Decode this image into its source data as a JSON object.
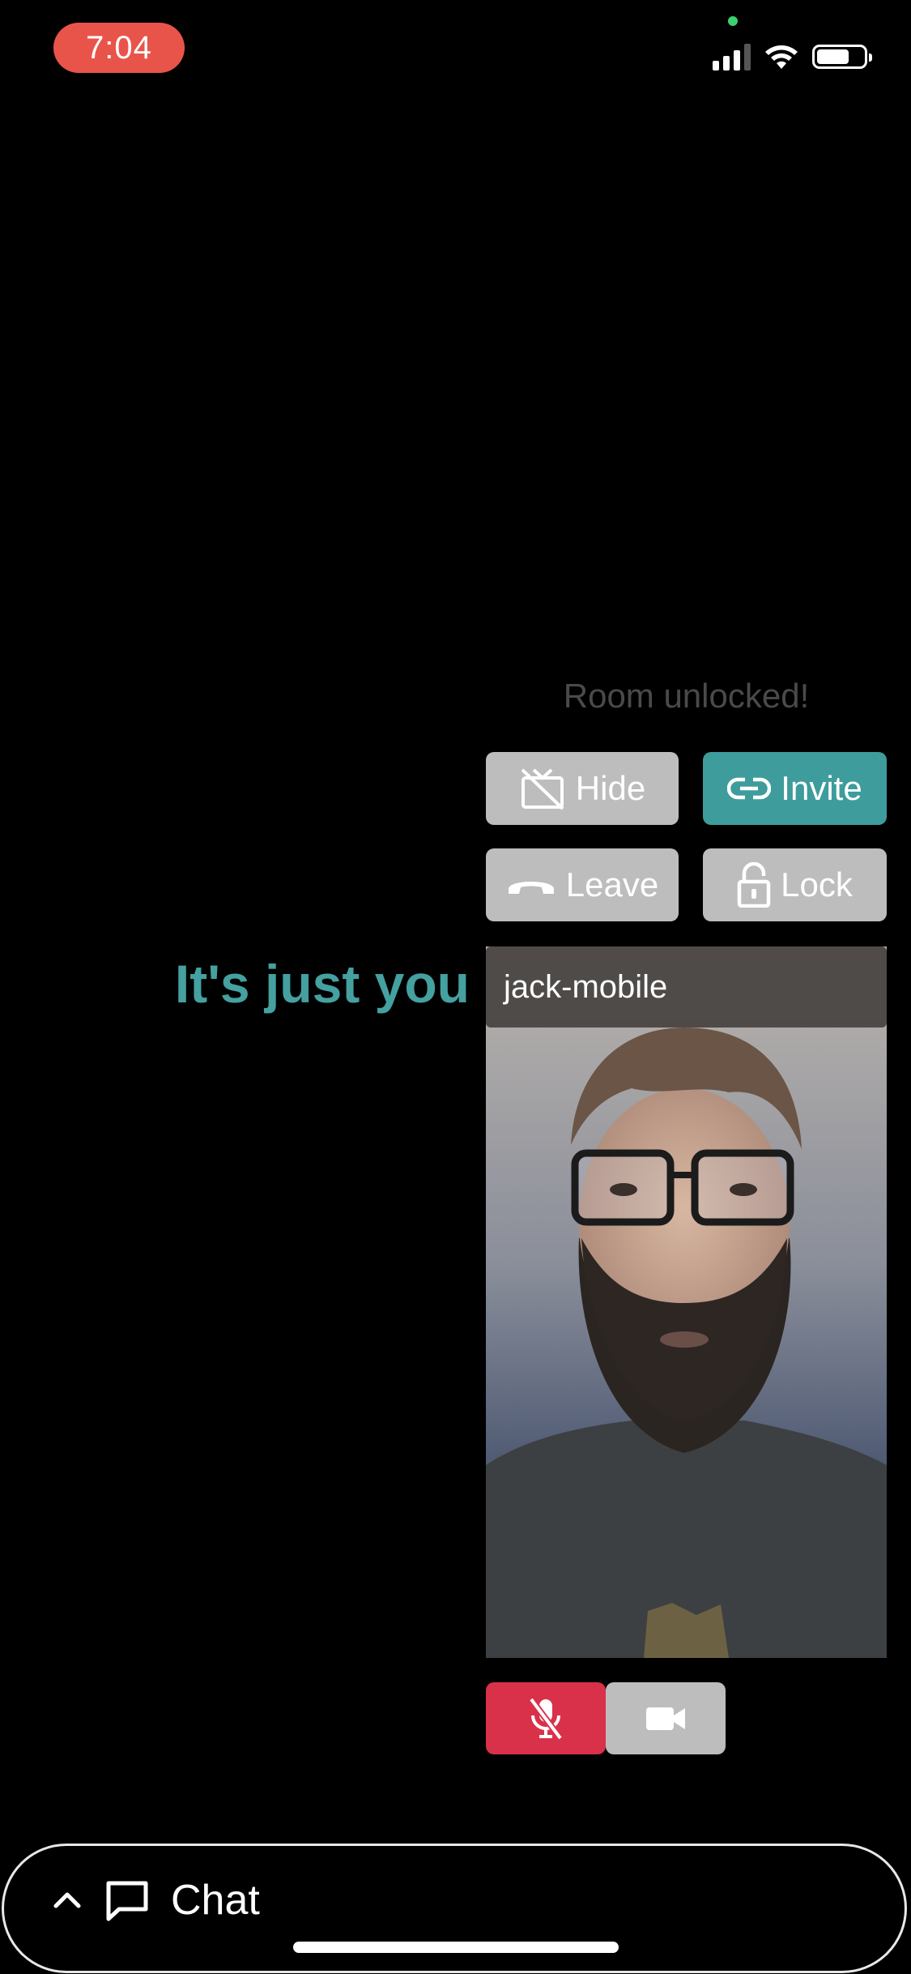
{
  "status_bar": {
    "time": "7:04",
    "icons": [
      "signal-icon",
      "wifi-icon",
      "battery-icon"
    ],
    "battery_level": 0.7
  },
  "room": {
    "status_text": "Room unlocked!",
    "alone_message": "It's just you"
  },
  "controls": {
    "hide_label": "Hide",
    "invite_label": "Invite",
    "leave_label": "Leave",
    "lock_label": "Lock"
  },
  "self_video": {
    "participant_name": "jack-mobile",
    "mic_muted": true,
    "camera_on": true
  },
  "chat": {
    "label": "Chat",
    "expanded": false
  },
  "colors": {
    "accent": "#45a0a0",
    "invite_button": "#3e9c9c",
    "neutral_button": "#bdbdbd",
    "muted_mic": "#d9314a",
    "time_pill": "#e9544a",
    "status_text": "#4a4a4a"
  }
}
